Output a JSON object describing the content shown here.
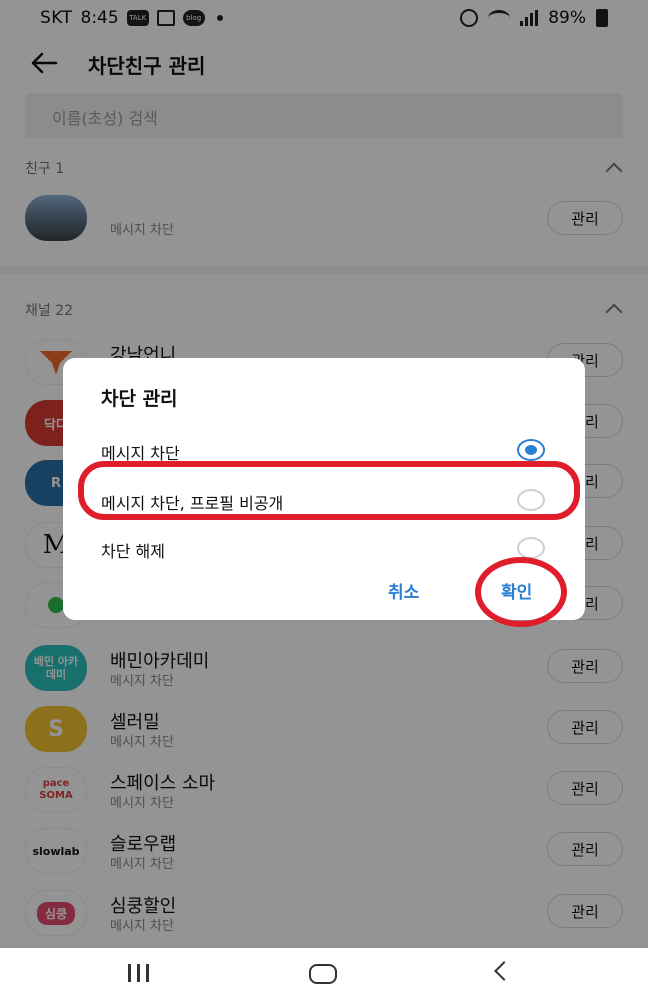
{
  "status_bar": {
    "carrier": "SKT",
    "time": "8:45",
    "notif_talk": "TALK",
    "notif_blog": "blog",
    "battery": "89%"
  },
  "header": {
    "title": "차단친구 관리"
  },
  "search": {
    "placeholder": "이름(초성) 검색"
  },
  "friends_section": {
    "label": "친구 1",
    "items": [
      {
        "name": "",
        "sub": "메시지 차단",
        "button": "관리"
      }
    ]
  },
  "channels_section": {
    "label": "채널 22",
    "items": [
      {
        "name": "강남언니",
        "sub": "",
        "button": "관리",
        "logo": "",
        "color": "#f26a2d"
      },
      {
        "name": "",
        "sub": "",
        "button": "관리",
        "logo": "닥다",
        "color": "#d63a2f"
      },
      {
        "name": "",
        "sub": "",
        "button": "관리",
        "logo": "R",
        "color": "#2a6fa8"
      },
      {
        "name": "",
        "sub": "",
        "button": "관리",
        "logo": "M",
        "color": "#ffffff"
      },
      {
        "name": "",
        "sub": "",
        "button": "관리",
        "logo": "",
        "color": "#ffffff"
      },
      {
        "name": "배민아카데미",
        "sub": "메시지 차단",
        "button": "관리",
        "logo": "배민 아카데미",
        "color": "#2ac1bc"
      },
      {
        "name": "셀러밀",
        "sub": "메시지 차단",
        "button": "관리",
        "logo": "S",
        "color": "#f2c230"
      },
      {
        "name": "스페이스 소마",
        "sub": "메시지 차단",
        "button": "관리",
        "logo": "pace SOMA",
        "color": "#ffffff"
      },
      {
        "name": "슬로우랩",
        "sub": "메시지 차단",
        "button": "관리",
        "logo": "slowlab",
        "color": "#ffffff"
      },
      {
        "name": "심쿵할인",
        "sub": "메시지 차단",
        "button": "관리",
        "logo": "심쿵",
        "color": "#e64b6f"
      }
    ]
  },
  "dialog": {
    "title": "차단 관리",
    "options": [
      {
        "label": "메시지 차단",
        "selected": true
      },
      {
        "label": "메시지 차단, 프로필 비공개",
        "selected": false
      },
      {
        "label": "차단 해제",
        "selected": false
      }
    ],
    "cancel": "취소",
    "confirm": "확인"
  },
  "colors": {
    "accent": "#2a7fd4",
    "annotation": "#e01d2b"
  }
}
